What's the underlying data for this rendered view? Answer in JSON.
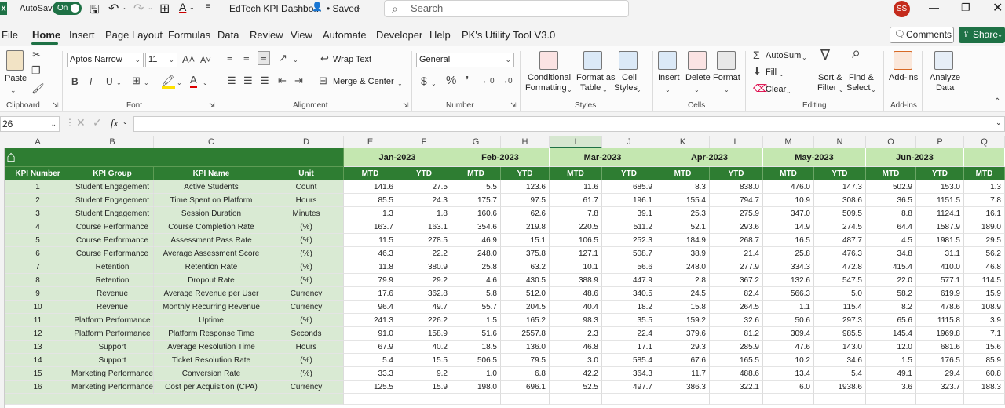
{
  "titlebar": {
    "app_letter": "X",
    "autosave_label": "AutoSave",
    "toggle_label": "On",
    "doc_title": "EdTech KPI Dashbo...",
    "saved_status": "• Saved",
    "search_placeholder": "Search",
    "avatar_initials": "SS"
  },
  "menu": {
    "items": [
      "File",
      "Home",
      "Insert",
      "Page Layout",
      "Formulas",
      "Data",
      "Review",
      "View",
      "Automate",
      "Developer",
      "Help",
      "PK's Utility Tool V3.0"
    ],
    "comments": "Comments",
    "share": "Share"
  },
  "ribbon": {
    "clipboard": {
      "paste": "Paste",
      "label": "Clipboard"
    },
    "font": {
      "name": "Aptos Narrow",
      "size": "11",
      "label": "Font"
    },
    "alignment": {
      "wrap": "Wrap Text",
      "merge": "Merge & Center",
      "label": "Alignment"
    },
    "number": {
      "format": "General",
      "label": "Number"
    },
    "styles": {
      "cond1": "Conditional",
      "cond2": "Formatting",
      "fmt1": "Format as",
      "fmt2": "Table",
      "cell1": "Cell",
      "cell2": "Styles",
      "label": "Styles"
    },
    "cells": {
      "insert": "Insert",
      "delete": "Delete",
      "format": "Format",
      "label": "Cells"
    },
    "editing": {
      "autosum": "AutoSum",
      "fill": "Fill",
      "clear": "Clear",
      "sort1": "Sort &",
      "sort2": "Filter",
      "find1": "Find &",
      "find2": "Select",
      "label": "Editing"
    },
    "addins": {
      "addins": "Add-ins",
      "label": "Add-ins"
    },
    "analyze": {
      "line1": "Analyze",
      "line2": "Data"
    }
  },
  "formula_bar": {
    "name_box": "26",
    "fx": "fx"
  },
  "columns": [
    "A",
    "B",
    "C",
    "D",
    "E",
    "F",
    "G",
    "H",
    "I",
    "J",
    "K",
    "L",
    "M",
    "N",
    "O",
    "P",
    "Q"
  ],
  "months": [
    "Jan-2023",
    "Feb-2023",
    "Mar-2023",
    "Apr-2023",
    "May-2023",
    "Jun-2023"
  ],
  "headers": {
    "kpi_number": "KPI Number",
    "kpi_group": "KPI Group",
    "kpi_name": "KPI Name",
    "unit": "Unit",
    "mtd": "MTD",
    "ytd": "YTD"
  },
  "rows": [
    {
      "n": "1",
      "g": "Student Engagement",
      "k": "Active Students",
      "u": "Count",
      "v": [
        "141.6",
        "27.5",
        "5.5",
        "123.6",
        "11.6",
        "685.9",
        "8.3",
        "838.0",
        "476.0",
        "147.3",
        "502.9",
        "153.0",
        "1.3"
      ]
    },
    {
      "n": "2",
      "g": "Student Engagement",
      "k": "Time Spent on Platform",
      "u": "Hours",
      "v": [
        "85.5",
        "24.3",
        "175.7",
        "97.5",
        "61.7",
        "196.1",
        "155.4",
        "794.7",
        "10.9",
        "308.6",
        "36.5",
        "1151.5",
        "7.8"
      ]
    },
    {
      "n": "3",
      "g": "Student Engagement",
      "k": "Session Duration",
      "u": "Minutes",
      "v": [
        "1.3",
        "1.8",
        "160.6",
        "62.6",
        "7.8",
        "39.1",
        "25.3",
        "275.9",
        "347.0",
        "509.5",
        "8.8",
        "1124.1",
        "16.1"
      ]
    },
    {
      "n": "4",
      "g": "Course Performance",
      "k": "Course Completion Rate",
      "u": "(%)",
      "v": [
        "163.7",
        "163.1",
        "354.6",
        "219.8",
        "220.5",
        "511.2",
        "52.1",
        "293.6",
        "14.9",
        "274.5",
        "64.4",
        "1587.9",
        "189.0"
      ]
    },
    {
      "n": "5",
      "g": "Course Performance",
      "k": "Assessment Pass Rate",
      "u": "(%)",
      "v": [
        "11.5",
        "278.5",
        "46.9",
        "15.1",
        "106.5",
        "252.3",
        "184.9",
        "268.7",
        "16.5",
        "487.7",
        "4.5",
        "1981.5",
        "29.5"
      ]
    },
    {
      "n": "6",
      "g": "Course Performance",
      "k": "Average Assessment Score",
      "u": "(%)",
      "v": [
        "46.3",
        "22.2",
        "248.0",
        "375.8",
        "127.1",
        "508.7",
        "38.9",
        "21.4",
        "25.8",
        "476.3",
        "34.8",
        "31.1",
        "56.2"
      ]
    },
    {
      "n": "7",
      "g": "Retention",
      "k": "Retention Rate",
      "u": "(%)",
      "v": [
        "11.8",
        "380.9",
        "25.8",
        "63.2",
        "10.1",
        "56.6",
        "248.0",
        "277.9",
        "334.3",
        "472.8",
        "415.4",
        "410.0",
        "46.8"
      ]
    },
    {
      "n": "8",
      "g": "Retention",
      "k": "Dropout Rate",
      "u": "(%)",
      "v": [
        "79.9",
        "29.2",
        "4.6",
        "430.5",
        "388.9",
        "447.9",
        "2.8",
        "367.2",
        "132.6",
        "547.5",
        "22.0",
        "577.1",
        "114.5"
      ]
    },
    {
      "n": "9",
      "g": "Revenue",
      "k": "Average Revenue per User",
      "u": "Currency",
      "v": [
        "17.6",
        "362.8",
        "5.8",
        "512.0",
        "48.6",
        "340.5",
        "24.5",
        "82.4",
        "566.3",
        "5.0",
        "58.2",
        "619.9",
        "15.9"
      ]
    },
    {
      "n": "10",
      "g": "Revenue",
      "k": "Monthly Recurring Revenue",
      "u": "Currency",
      "v": [
        "96.4",
        "49.7",
        "55.7",
        "204.5",
        "40.4",
        "18.2",
        "15.8",
        "264.5",
        "1.1",
        "115.4",
        "8.2",
        "478.6",
        "108.9"
      ]
    },
    {
      "n": "11",
      "g": "Platform Performance",
      "k": "Uptime",
      "u": "(%)",
      "v": [
        "241.3",
        "226.2",
        "1.5",
        "165.2",
        "98.3",
        "35.5",
        "159.2",
        "32.6",
        "50.6",
        "297.3",
        "65.6",
        "1115.8",
        "3.9"
      ]
    },
    {
      "n": "12",
      "g": "Platform Performance",
      "k": "Platform Response Time",
      "u": "Seconds",
      "v": [
        "91.0",
        "158.9",
        "51.6",
        "2557.8",
        "2.3",
        "22.4",
        "379.6",
        "81.2",
        "309.4",
        "985.5",
        "145.4",
        "1969.8",
        "7.1"
      ]
    },
    {
      "n": "13",
      "g": "Support",
      "k": "Average Resolution Time",
      "u": "Hours",
      "v": [
        "67.9",
        "40.2",
        "18.5",
        "136.0",
        "46.8",
        "17.1",
        "29.3",
        "285.9",
        "47.6",
        "143.0",
        "12.0",
        "681.6",
        "15.6"
      ]
    },
    {
      "n": "14",
      "g": "Support",
      "k": "Ticket Resolution Rate",
      "u": "(%)",
      "v": [
        "5.4",
        "15.5",
        "506.5",
        "79.5",
        "3.0",
        "585.4",
        "67.6",
        "165.5",
        "10.2",
        "34.6",
        "1.5",
        "176.5",
        "85.9"
      ]
    },
    {
      "n": "15",
      "g": "Marketing Performance",
      "k": "Conversion Rate",
      "u": "(%)",
      "v": [
        "33.3",
        "9.2",
        "1.0",
        "6.8",
        "42.2",
        "364.3",
        "11.7",
        "488.6",
        "13.4",
        "5.4",
        "49.1",
        "29.4",
        "60.8"
      ]
    },
    {
      "n": "16",
      "g": "Marketing Performance",
      "k": "Cost per Acquisition (CPA)",
      "u": "Currency",
      "v": [
        "125.5",
        "15.9",
        "198.0",
        "696.1",
        "52.5",
        "497.7",
        "386.3",
        "322.1",
        "6.0",
        "1938.6",
        "3.6",
        "323.7",
        "188.3"
      ]
    }
  ],
  "colors": {
    "excel_green": "#1e7145",
    "header_dark_green": "#2e7d32",
    "month_light_green": "#c4e7b0",
    "kpi_cells_green": "#d9ead3"
  }
}
